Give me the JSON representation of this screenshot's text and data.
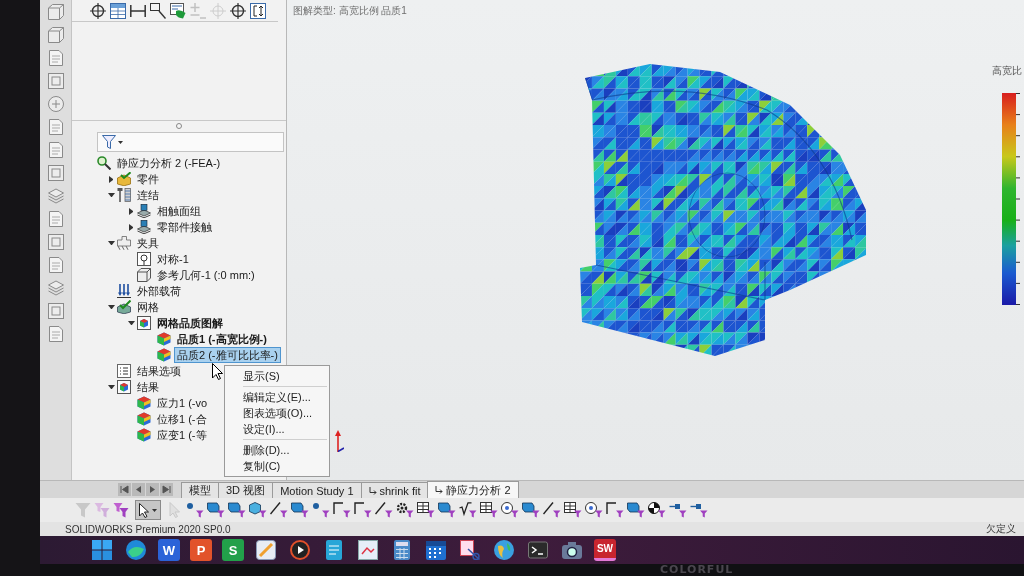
{
  "panel_toolbar": [
    {
      "kind": "crosshair",
      "disabled": false
    },
    {
      "kind": "table",
      "disabled": false
    },
    {
      "kind": "span",
      "disabled": false
    },
    {
      "kind": "boxline",
      "disabled": false
    },
    {
      "kind": "sheet",
      "disabled": false
    },
    {
      "kind": "plusminus",
      "disabled": true
    },
    {
      "kind": "target",
      "disabled": true
    },
    {
      "kind": "crosshair",
      "disabled": false
    },
    {
      "kind": "bracket",
      "disabled": false
    }
  ],
  "tree": [
    {
      "label": "静应力分析 2 (-FEA-)",
      "kind": "study",
      "selected": false,
      "active": false,
      "children": [
        {
          "label": "零件",
          "kind": "part",
          "expanded": false,
          "selected": false,
          "active": false
        },
        {
          "label": "连结",
          "kind": "connection",
          "expanded": true,
          "selected": false,
          "active": false,
          "children": [
            {
              "label": "相触面组",
              "kind": "contact",
              "expanded": false,
              "selected": false,
              "active": false
            },
            {
              "label": "零部件接触",
              "kind": "contact",
              "expanded": false,
              "selected": false,
              "active": false
            }
          ]
        },
        {
          "label": "夹具",
          "kind": "fixture",
          "expanded": true,
          "selected": false,
          "active": false,
          "children": [
            {
              "label": "对称-1",
              "kind": "symmetry",
              "selected": false,
              "active": false
            },
            {
              "label": "参考几何-1 (:0 mm:)",
              "kind": "refgeom",
              "selected": false,
              "active": false
            }
          ]
        },
        {
          "label": "外部载荷",
          "kind": "load",
          "selected": false,
          "active": false
        },
        {
          "label": "网格",
          "kind": "mesh",
          "expanded": true,
          "selected": false,
          "active": false,
          "children": [
            {
              "label": "网格品质图解",
              "kind": "plotfolder",
              "expanded": true,
              "selected": false,
              "active": true,
              "children": [
                {
                  "label": "品质1 (-高宽比例-)",
                  "kind": "plot",
                  "selected": false,
                  "active": true
                },
                {
                  "label": "品质2 (-雅可比比率-)",
                  "kind": "plot",
                  "selected": true,
                  "active": false
                }
              ]
            }
          ]
        },
        {
          "label": "结果选项",
          "kind": "options",
          "selected": false,
          "active": false
        },
        {
          "label": "结果",
          "kind": "plotfolder",
          "expanded": true,
          "selected": false,
          "active": false,
          "children": [
            {
              "label": "应力1 (-vo",
              "kind": "plot",
              "selected": false,
              "active": false
            },
            {
              "label": "位移1 (-合",
              "kind": "plot",
              "selected": false,
              "active": false
            },
            {
              "label": "应变1 (-等",
              "kind": "plot",
              "selected": false,
              "active": false
            }
          ]
        }
      ]
    }
  ],
  "graphics": {
    "caption": "图解类型: 高宽比例 品质1",
    "legend": {
      "title": "高宽比"
    }
  },
  "context_menu": {
    "groups": [
      [
        "显示(S)"
      ],
      [
        "编辑定义(E)...",
        "图表选项(O)...",
        "设定(I)..."
      ],
      [
        "删除(D)...",
        "复制(C)"
      ]
    ]
  },
  "tabs": [
    {
      "label": "模型",
      "kind": "plain",
      "selected": false
    },
    {
      "label": "3D 视图",
      "kind": "plain",
      "selected": false
    },
    {
      "label": "Motion Study 1",
      "kind": "plain",
      "selected": false
    },
    {
      "label": "shrink fit",
      "kind": "study",
      "selected": false
    },
    {
      "label": "静应力分析 2",
      "kind": "study",
      "selected": true
    }
  ],
  "filter_toolbar": {
    "leading": [
      {
        "kind": "funnel",
        "disabled": true
      },
      {
        "kind": "stack",
        "disabled": true
      },
      {
        "kind": "stack",
        "disabled": false
      }
    ],
    "select_tool": {
      "pressed": true
    },
    "trailing": [
      {
        "kind": "cursor",
        "disabled": true
      },
      {
        "kind": "dot",
        "disabled": false
      },
      {
        "kind": "square",
        "disabled": false
      },
      {
        "kind": "square",
        "disabled": false
      },
      {
        "kind": "cube",
        "disabled": false
      },
      {
        "kind": "line",
        "disabled": false
      },
      {
        "kind": "square",
        "disabled": false
      },
      {
        "kind": "dot",
        "disabled": false
      },
      {
        "kind": "corner",
        "disabled": false
      },
      {
        "kind": "corner",
        "disabled": false
      },
      {
        "kind": "line",
        "disabled": false
      },
      {
        "kind": "gear",
        "disabled": false
      },
      {
        "kind": "grid",
        "disabled": false
      },
      {
        "kind": "square",
        "disabled": false
      },
      {
        "kind": "radical",
        "disabled": false
      },
      {
        "kind": "grid",
        "disabled": false
      },
      {
        "kind": "circle",
        "disabled": false
      },
      {
        "kind": "square",
        "disabled": false
      },
      {
        "kind": "line",
        "disabled": false
      },
      {
        "kind": "grid",
        "disabled": false
      },
      {
        "kind": "circle",
        "disabled": false
      },
      {
        "kind": "corner",
        "disabled": false
      },
      {
        "kind": "square",
        "disabled": false
      },
      {
        "kind": "quadrant",
        "disabled": false
      },
      {
        "kind": "pin",
        "disabled": false
      },
      {
        "kind": "pin",
        "disabled": false
      }
    ]
  },
  "status_bar": {
    "product": "SOLIDWORKS Premium 2020 SP0.0",
    "definition_state": "欠定义"
  },
  "taskbar": {
    "apps": [
      {
        "kind": "start",
        "active": false
      },
      {
        "kind": "browser",
        "active": false
      },
      {
        "kind": "letter",
        "letter": "W",
        "color": "#2b63d8",
        "active": false
      },
      {
        "kind": "letter",
        "letter": "P",
        "color": "#e2532b",
        "active": false
      },
      {
        "kind": "letter",
        "letter": "S",
        "color": "#22a04a",
        "active": false
      },
      {
        "kind": "pen",
        "active": false
      },
      {
        "kind": "player",
        "active": false
      },
      {
        "kind": "notes",
        "active": false
      },
      {
        "kind": "document",
        "active": false
      },
      {
        "kind": "calculator",
        "active": false
      },
      {
        "kind": "calendar",
        "active": false
      },
      {
        "kind": "snip",
        "active": false
      },
      {
        "kind": "globe",
        "active": false
      },
      {
        "kind": "terminal",
        "active": false
      },
      {
        "kind": "camera",
        "active": false
      },
      {
        "kind": "letter",
        "letter": "SW",
        "color": "#c8252f",
        "active": true
      }
    ]
  },
  "bezel": {
    "logo": "COLORFUL"
  }
}
